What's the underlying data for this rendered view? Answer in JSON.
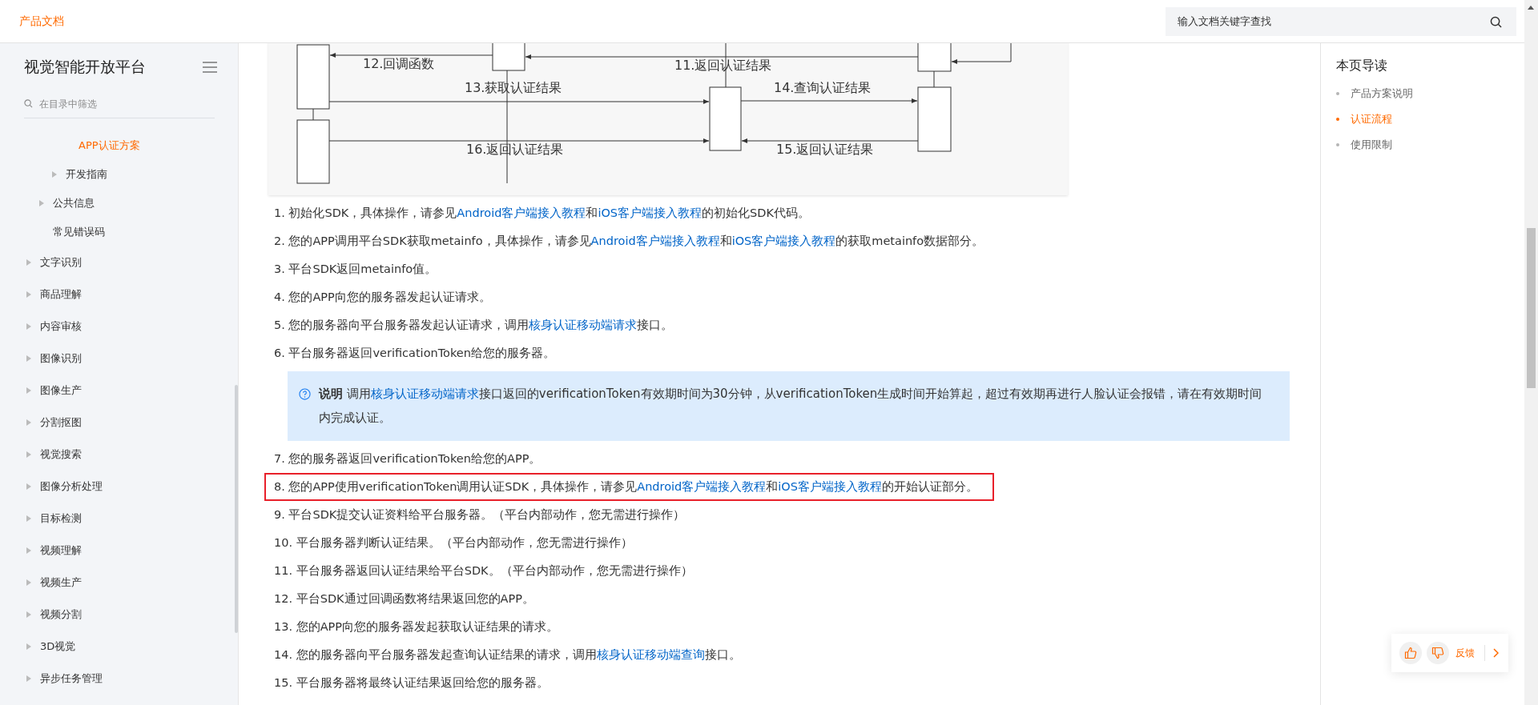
{
  "header": {
    "brand": "产品文档",
    "search": {
      "placeholder": "输入文档关键字查找"
    }
  },
  "sidebar": {
    "title": "视觉智能开放平台",
    "filter": {
      "placeholder": "在目录中筛选"
    },
    "tree": [
      {
        "children": [
          {
            "children": [
              {
                "children": [
                  {
                    "label": "APP认证方案",
                    "selected": true
                  }
                ]
              },
              {
                "label": "开发指南",
                "expanded": false,
                "selected": false
              }
            ]
          },
          {
            "label": "公共信息",
            "expanded": false,
            "selected": false
          },
          {
            "label": "常见错误码",
            "selected": false
          }
        ]
      },
      {
        "label": "文字识别",
        "expanded": false,
        "selected": false
      },
      {
        "label": "商品理解",
        "expanded": false,
        "selected": false
      },
      {
        "label": "内容审核",
        "expanded": false,
        "selected": false
      },
      {
        "label": "图像识别",
        "expanded": false,
        "selected": false
      },
      {
        "label": "图像生产",
        "expanded": false,
        "selected": false
      },
      {
        "label": "分割抠图",
        "expanded": false,
        "selected": false
      },
      {
        "label": "视觉搜索",
        "expanded": false,
        "selected": false
      },
      {
        "label": "图像分析处理",
        "expanded": false,
        "selected": false
      },
      {
        "label": "目标检测",
        "expanded": false,
        "selected": false
      },
      {
        "label": "视频理解",
        "expanded": false,
        "selected": false
      },
      {
        "label": "视频生产",
        "expanded": false,
        "selected": false
      },
      {
        "label": "视频分割",
        "expanded": false,
        "selected": false
      },
      {
        "label": "3D视觉",
        "expanded": false,
        "selected": false
      },
      {
        "label": "异步任务管理",
        "expanded": false,
        "selected": false
      }
    ]
  },
  "diagram": {
    "labels": [
      "12.回调函数",
      "11.返回认证结果",
      "13.获取认证结果",
      "14.查询认证结果",
      "16.返回认证结果",
      "15.返回认证结果"
    ]
  },
  "steps": [
    {
      "kind": "step",
      "number": "1.",
      "highlighted": false,
      "segments": [
        {
          "text": "初始化SDK，具体操作，请参见"
        },
        {
          "text": "Android客户端接入教程",
          "link": true
        },
        {
          "text": "和"
        },
        {
          "text": "iOS客户端接入教程",
          "link": true
        },
        {
          "text": "的初始化SDK代码。"
        }
      ]
    },
    {
      "kind": "step",
      "number": "2.",
      "highlighted": false,
      "segments": [
        {
          "text": "您的APP调用平台SDK获取metainfo，具体操作，请参见"
        },
        {
          "text": "Android客户端接入教程",
          "link": true
        },
        {
          "text": "和"
        },
        {
          "text": "iOS客户端接入教程",
          "link": true
        },
        {
          "text": "的获取metainfo数据部分。"
        }
      ]
    },
    {
      "kind": "step",
      "number": "3.",
      "highlighted": false,
      "segments": [
        {
          "text": "平台SDK返回metainfo值。"
        }
      ]
    },
    {
      "kind": "step",
      "number": "4.",
      "highlighted": false,
      "segments": [
        {
          "text": "您的APP向您的服务器发起认证请求。"
        }
      ]
    },
    {
      "kind": "step",
      "number": "5.",
      "highlighted": false,
      "segments": [
        {
          "text": "您的服务器向平台服务器发起认证请求，调用"
        },
        {
          "text": "核身认证移动端请求",
          "link": true
        },
        {
          "text": "接口。"
        }
      ]
    },
    {
      "kind": "step",
      "number": "6.",
      "highlighted": false,
      "segments": [
        {
          "text": "平台服务器返回verificationToken给您的服务器。"
        }
      ]
    },
    {
      "kind": "note",
      "label": "说明",
      "segments": [
        {
          "text": "调用"
        },
        {
          "text": "核身认证移动端请求",
          "link": true
        },
        {
          "text": "接口返回的verificationToken有效期时间为30分钟，从verificationToken生成时间开始算起，超过有效期再进行人脸认证会报错，请在有效期时间内完成认证。"
        }
      ]
    },
    {
      "kind": "step",
      "number": "7.",
      "highlighted": false,
      "segments": [
        {
          "text": "您的服务器返回verificationToken给您的APP。"
        }
      ]
    },
    {
      "kind": "step",
      "number": "8.",
      "highlighted": true,
      "segments": [
        {
          "text": "您的APP使用verificationToken调用认证SDK，具体操作，请参见"
        },
        {
          "text": "Android客户端接入教程",
          "link": true
        },
        {
          "text": "和"
        },
        {
          "text": "iOS客户端接入教程",
          "link": true
        },
        {
          "text": "的开始认证部分。"
        }
      ]
    },
    {
      "kind": "step",
      "number": "9.",
      "highlighted": false,
      "segments": [
        {
          "text": "平台SDK提交认证资料给平台服务器。（平台内部动作，您无需进行操作）"
        }
      ]
    },
    {
      "kind": "step",
      "number": "10.",
      "highlighted": false,
      "segments": [
        {
          "text": "平台服务器判断认证结果。（平台内部动作，您无需进行操作）"
        }
      ]
    },
    {
      "kind": "step",
      "number": "11.",
      "highlighted": false,
      "segments": [
        {
          "text": "平台服务器返回认证结果给平台SDK。（平台内部动作，您无需进行操作）"
        }
      ]
    },
    {
      "kind": "step",
      "number": "12.",
      "highlighted": false,
      "segments": [
        {
          "text": "平台SDK通过回调函数将结果返回您的APP。"
        }
      ]
    },
    {
      "kind": "step",
      "number": "13.",
      "highlighted": false,
      "segments": [
        {
          "text": "您的APP向您的服务器发起获取认证结果的请求。"
        }
      ]
    },
    {
      "kind": "step",
      "number": "14.",
      "highlighted": false,
      "segments": [
        {
          "text": "您的服务器向平台服务器发起查询认证结果的请求，调用"
        },
        {
          "text": "核身认证移动端查询",
          "link": true
        },
        {
          "text": "接口。"
        }
      ]
    },
    {
      "kind": "step",
      "number": "15.",
      "highlighted": false,
      "segments": [
        {
          "text": "平台服务器将最终认证结果返回给您的服务器。"
        }
      ]
    }
  ],
  "toc": {
    "title": "本页导读",
    "items": [
      {
        "label": "产品方案说明",
        "selected": false
      },
      {
        "label": "认证流程",
        "selected": true
      },
      {
        "label": "使用限制",
        "selected": false
      }
    ]
  },
  "feedback": {
    "label": "反馈"
  }
}
